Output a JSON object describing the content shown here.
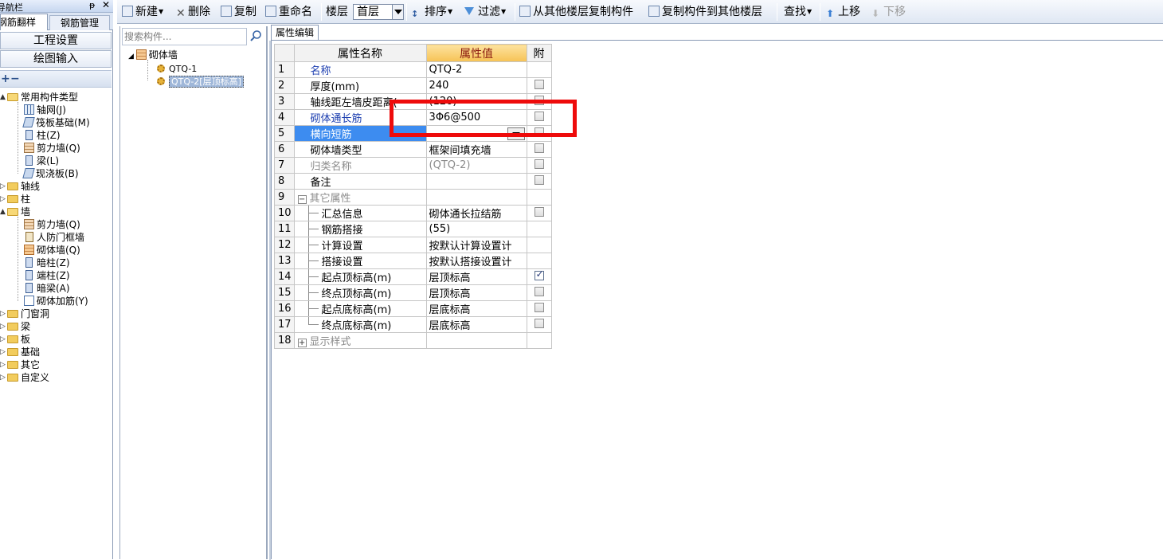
{
  "nav": {
    "title": "导航栏",
    "tabs": [
      "钢筋翻样",
      "钢筋管理"
    ],
    "project_settings": "工程设置",
    "drawing_input": "绘图输入",
    "tree": [
      {
        "label": "常用构件类型",
        "kind": "folder-open",
        "level": 0,
        "expander": "▲"
      },
      {
        "label": "轴网(J)",
        "kind": "grid-icon",
        "level": 1
      },
      {
        "label": "筏板基础(M)",
        "kind": "slab-icon",
        "level": 1
      },
      {
        "label": "柱(Z)",
        "kind": "column-icon",
        "level": 1
      },
      {
        "label": "剪力墙(Q)",
        "kind": "wall-icon",
        "level": 1
      },
      {
        "label": "梁(L)",
        "kind": "beam-icon",
        "level": 1
      },
      {
        "label": "现浇板(B)",
        "kind": "slab-icon",
        "level": 1
      },
      {
        "label": "轴线",
        "kind": "folder",
        "level": 0,
        "expander": "▷"
      },
      {
        "label": "柱",
        "kind": "folder",
        "level": 0,
        "expander": "▷"
      },
      {
        "label": "墙",
        "kind": "folder-open",
        "level": 0,
        "expander": "▲"
      },
      {
        "label": "剪力墙(Q)",
        "kind": "wall-icon",
        "level": 1
      },
      {
        "label": "人防门框墙",
        "kind": "door-icon",
        "level": 1
      },
      {
        "label": "砌体墙(Q)",
        "kind": "brick-icon",
        "level": 1
      },
      {
        "label": "暗柱(Z)",
        "kind": "column-icon",
        "level": 1
      },
      {
        "label": "端柱(Z)",
        "kind": "column-icon",
        "level": 1
      },
      {
        "label": "暗梁(A)",
        "kind": "beam-icon",
        "level": 1
      },
      {
        "label": "砌体加筋(Y)",
        "kind": "rebar-icon",
        "level": 1
      },
      {
        "label": "门窗洞",
        "kind": "folder",
        "level": 0,
        "expander": "▷"
      },
      {
        "label": "梁",
        "kind": "folder",
        "level": 0,
        "expander": "▷"
      },
      {
        "label": "板",
        "kind": "folder",
        "level": 0,
        "expander": "▷"
      },
      {
        "label": "基础",
        "kind": "folder",
        "level": 0,
        "expander": "▷"
      },
      {
        "label": "其它",
        "kind": "folder",
        "level": 0,
        "expander": "▷"
      },
      {
        "label": "自定义",
        "kind": "folder",
        "level": 0,
        "expander": "▷"
      }
    ]
  },
  "toolbar": {
    "new": "新建",
    "delete": "删除",
    "copy": "复制",
    "rename": "重命名",
    "floor_label": "楼层",
    "floor_value": "首层",
    "sort": "排序",
    "filter": "过滤",
    "copy_from_other_floor": "从其他楼层复制构件",
    "copy_to_other_floor": "复制构件到其他楼层",
    "find": "查找",
    "move_up": "上移",
    "move_down": "下移"
  },
  "components": {
    "search_placeholder": "搜索构件...",
    "root": "砌体墙",
    "items": [
      "QTQ-1",
      "QTQ-2[层顶标高]"
    ]
  },
  "property_editor": {
    "tab": "属性编辑",
    "headers": {
      "name": "属性名称",
      "value": "属性值",
      "extra": "附"
    },
    "rows": [
      {
        "idx": "1",
        "name": "名称",
        "value": "QTQ-2",
        "style": "blue",
        "check": "none"
      },
      {
        "idx": "2",
        "name": "厚度(mm)",
        "value": "240",
        "style": "normal",
        "check": "off"
      },
      {
        "idx": "3",
        "name": "轴线距左墙皮距离(",
        "value": "(120)",
        "style": "normal",
        "check": "off"
      },
      {
        "idx": "4",
        "name": "砌体通长筋",
        "value": "3Φ6@500",
        "style": "blue",
        "check": "off"
      },
      {
        "idx": "5",
        "name": "横向短筋",
        "value": "",
        "style": "active",
        "check": "off"
      },
      {
        "idx": "6",
        "name": "砌体墙类型",
        "value": "框架间填充墙",
        "style": "normal",
        "check": "off"
      },
      {
        "idx": "7",
        "name": "归类名称",
        "value": "(QTQ-2)",
        "style": "grey",
        "check": "off"
      },
      {
        "idx": "8",
        "name": "备注",
        "value": "",
        "style": "normal",
        "check": "off"
      },
      {
        "idx": "9",
        "name": "其它属性",
        "value": "",
        "style": "group-open",
        "check": "none"
      },
      {
        "idx": "10",
        "name": "汇总信息",
        "value": "砌体通长拉结筋",
        "style": "sub",
        "check": "off"
      },
      {
        "idx": "11",
        "name": "钢筋搭接",
        "value": "(55)",
        "style": "sub",
        "check": "none"
      },
      {
        "idx": "12",
        "name": "计算设置",
        "value": "按默认计算设置计",
        "style": "sub",
        "check": "none"
      },
      {
        "idx": "13",
        "name": "搭接设置",
        "value": "按默认搭接设置计",
        "style": "sub",
        "check": "none"
      },
      {
        "idx": "14",
        "name": "起点顶标高(m)",
        "value": "层顶标高",
        "style": "sub",
        "check": "on"
      },
      {
        "idx": "15",
        "name": "终点顶标高(m)",
        "value": "层顶标高",
        "style": "sub",
        "check": "off"
      },
      {
        "idx": "16",
        "name": "起点底标高(m)",
        "value": "层底标高",
        "style": "sub",
        "check": "off"
      },
      {
        "idx": "17",
        "name": "终点底标高(m)",
        "value": "层底标高",
        "style": "sub-last",
        "check": "off"
      },
      {
        "idx": "18",
        "name": "显示样式",
        "value": "",
        "style": "group-closed",
        "check": "none"
      }
    ]
  },
  "colors": {
    "highlight": "#ee0b0b",
    "active_row": "#3d8cf0",
    "value_header": "#f6c255"
  }
}
